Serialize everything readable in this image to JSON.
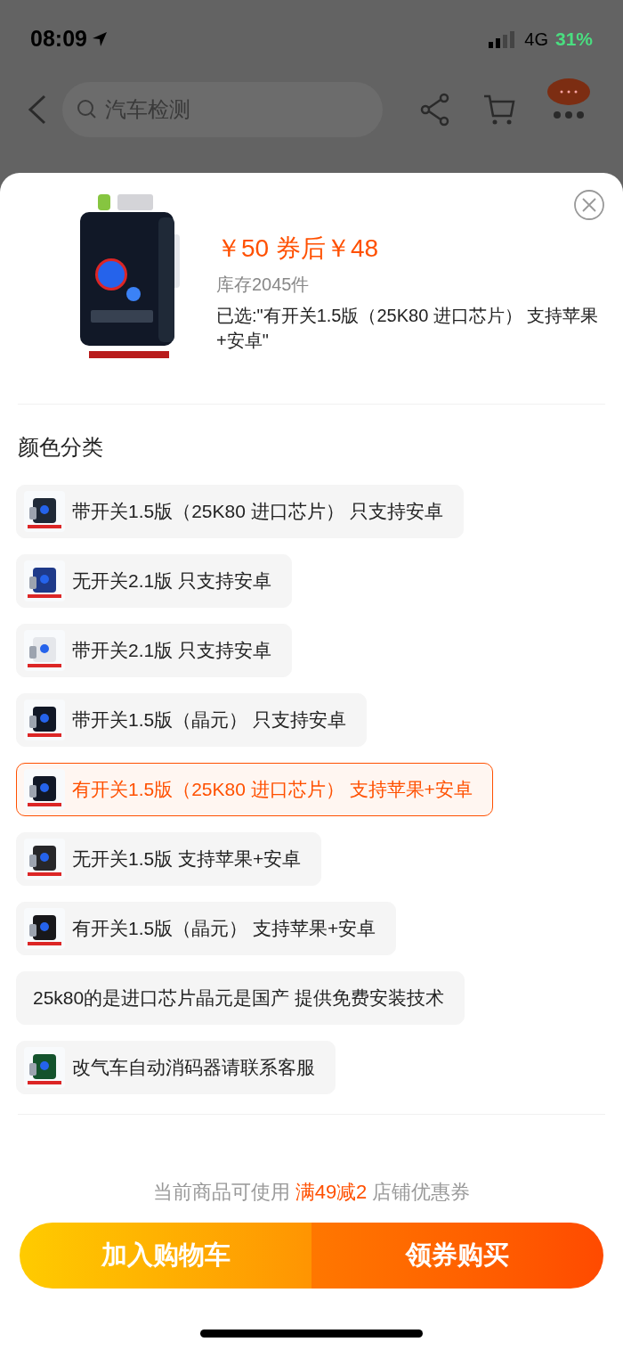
{
  "status_bar": {
    "time": "08:09",
    "network": "4G",
    "battery": "31%"
  },
  "nav": {
    "search_placeholder": "汽车检测"
  },
  "product": {
    "price": "￥50 券后￥48",
    "stock": "库存2045件",
    "selected_text": "已选:\"有开关1.5版（25K80 进口芯片） 支持苹果+安卓\""
  },
  "section_title": "颜色分类",
  "options": [
    {
      "label": "带开关1.5版（25K80 进口芯片） 只支持安卓",
      "kind": "thumbnail",
      "selected": false
    },
    {
      "label": "无开关2.1版 只支持安卓",
      "kind": "thumbnail",
      "selected": false
    },
    {
      "label": "带开关2.1版 只支持安卓",
      "kind": "thumbnail",
      "selected": false
    },
    {
      "label": "带开关1.5版（晶元） 只支持安卓",
      "kind": "thumbnail",
      "selected": false
    },
    {
      "label": "有开关1.5版（25K80 进口芯片） 支持苹果+安卓",
      "kind": "thumbnail",
      "selected": true
    },
    {
      "label": "无开关1.5版 支持苹果+安卓",
      "kind": "thumbnail",
      "selected": false
    },
    {
      "label": "有开关1.5版（晶元） 支持苹果+安卓",
      "kind": "thumbnail",
      "selected": false
    },
    {
      "label": "25k80的是进口芯片晶元是国产 提供免费安装技术",
      "kind": "text",
      "selected": false
    },
    {
      "label": "改气车自动消码器请联系客服",
      "kind": "thumbnail",
      "selected": false
    }
  ],
  "coupon": {
    "prefix": "当前商品可使用",
    "highlight": "满49减2",
    "suffix": "店铺优惠券"
  },
  "buttons": [
    {
      "label": "加入购物车",
      "kind": "cart"
    },
    {
      "label": "领券购买",
      "kind": "buy"
    }
  ]
}
